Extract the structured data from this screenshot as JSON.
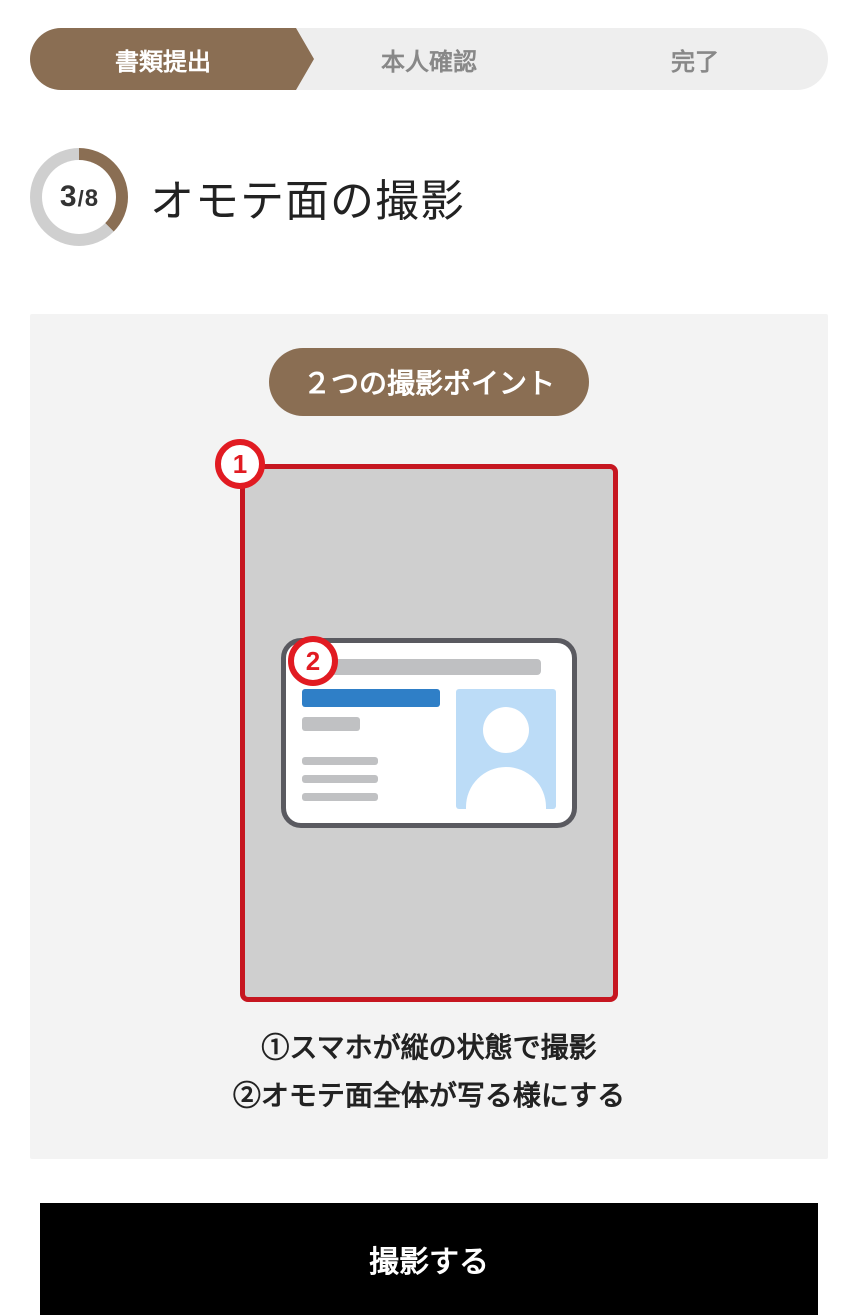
{
  "steps": {
    "s1": "書類提出",
    "s2": "本人確認",
    "s3": "完了"
  },
  "progress": {
    "current": "3",
    "total": "8"
  },
  "title": "オモテ面の撮影",
  "pill": "２つの撮影ポイント",
  "badges": {
    "b1": "1",
    "b2": "2"
  },
  "tips": {
    "t1": "①スマホが縦の状態で撮影",
    "t2": "②オモテ面全体が写る様にする"
  },
  "cta": "撮影する"
}
